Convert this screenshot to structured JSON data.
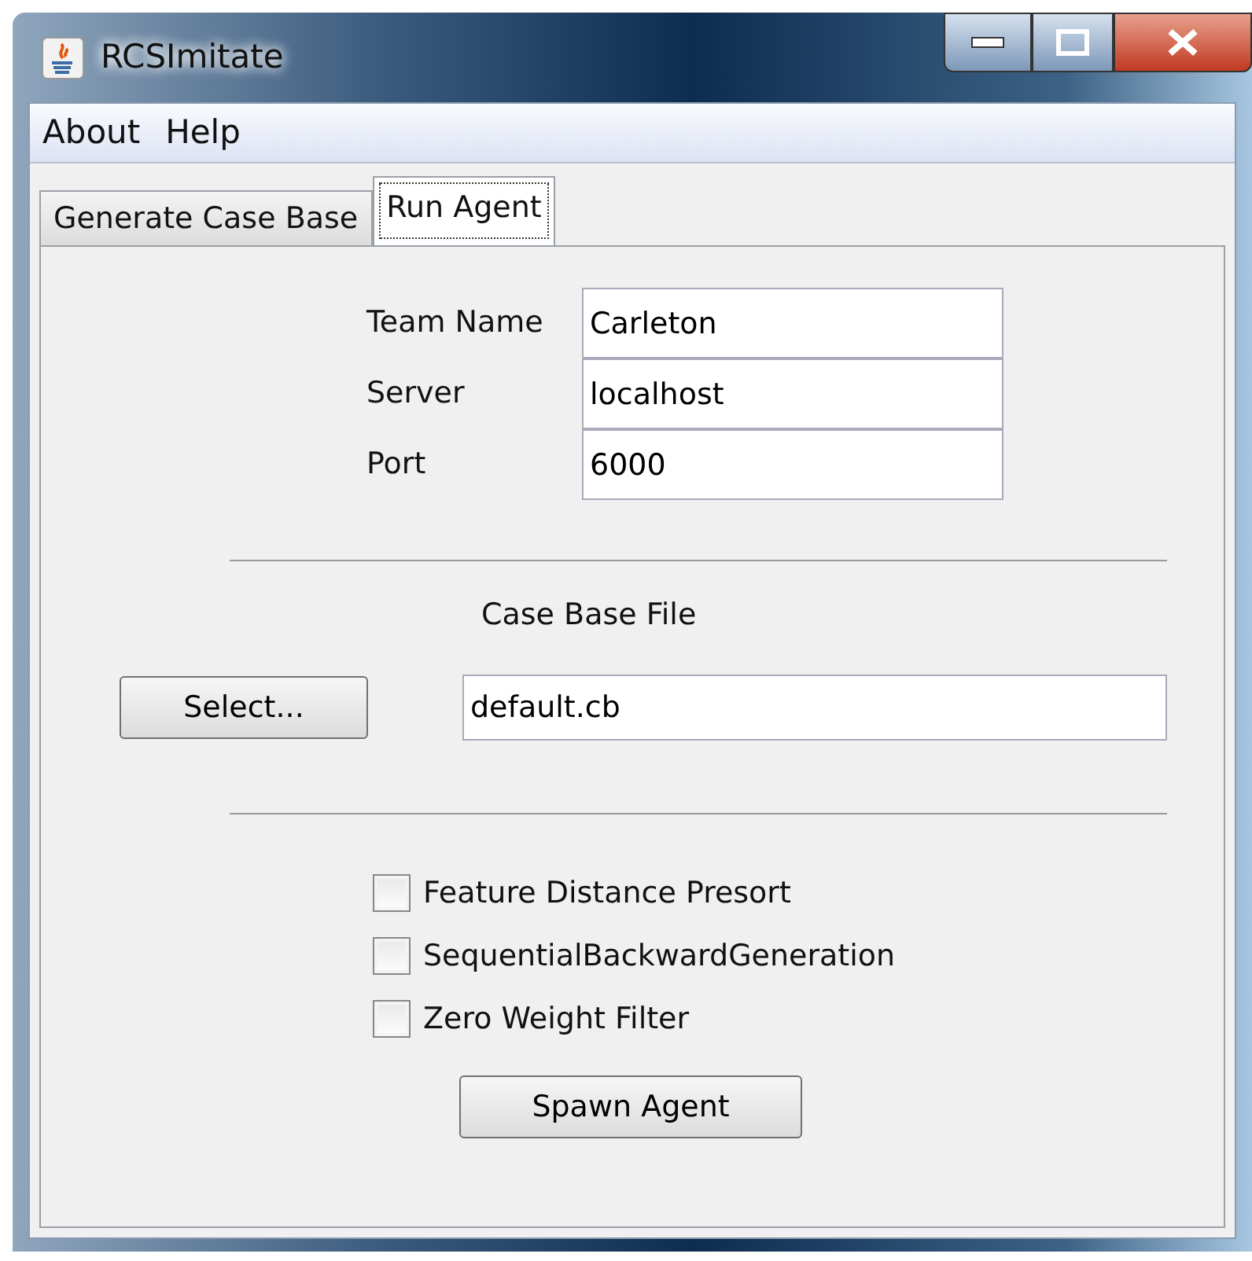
{
  "window": {
    "title": "RCSImitate"
  },
  "menu": [
    "About",
    "Help"
  ],
  "tabs": [
    {
      "label": "Generate Case Base",
      "selected": false
    },
    {
      "label": "Run Agent",
      "selected": true
    }
  ],
  "fields": [
    {
      "label": "Team Name",
      "value": "Carleton"
    },
    {
      "label": "Server",
      "value": "localhost"
    },
    {
      "label": "Port",
      "value": "6000"
    }
  ],
  "case_base": {
    "heading": "Case Base File",
    "button": "Select...",
    "value": "default.cb"
  },
  "options": [
    {
      "label": "Feature Distance Presort",
      "checked": false
    },
    {
      "label": "SequentialBackwardGeneration",
      "checked": false
    },
    {
      "label": "Zero Weight Filter",
      "checked": false
    }
  ],
  "action_button": "Spawn Agent"
}
